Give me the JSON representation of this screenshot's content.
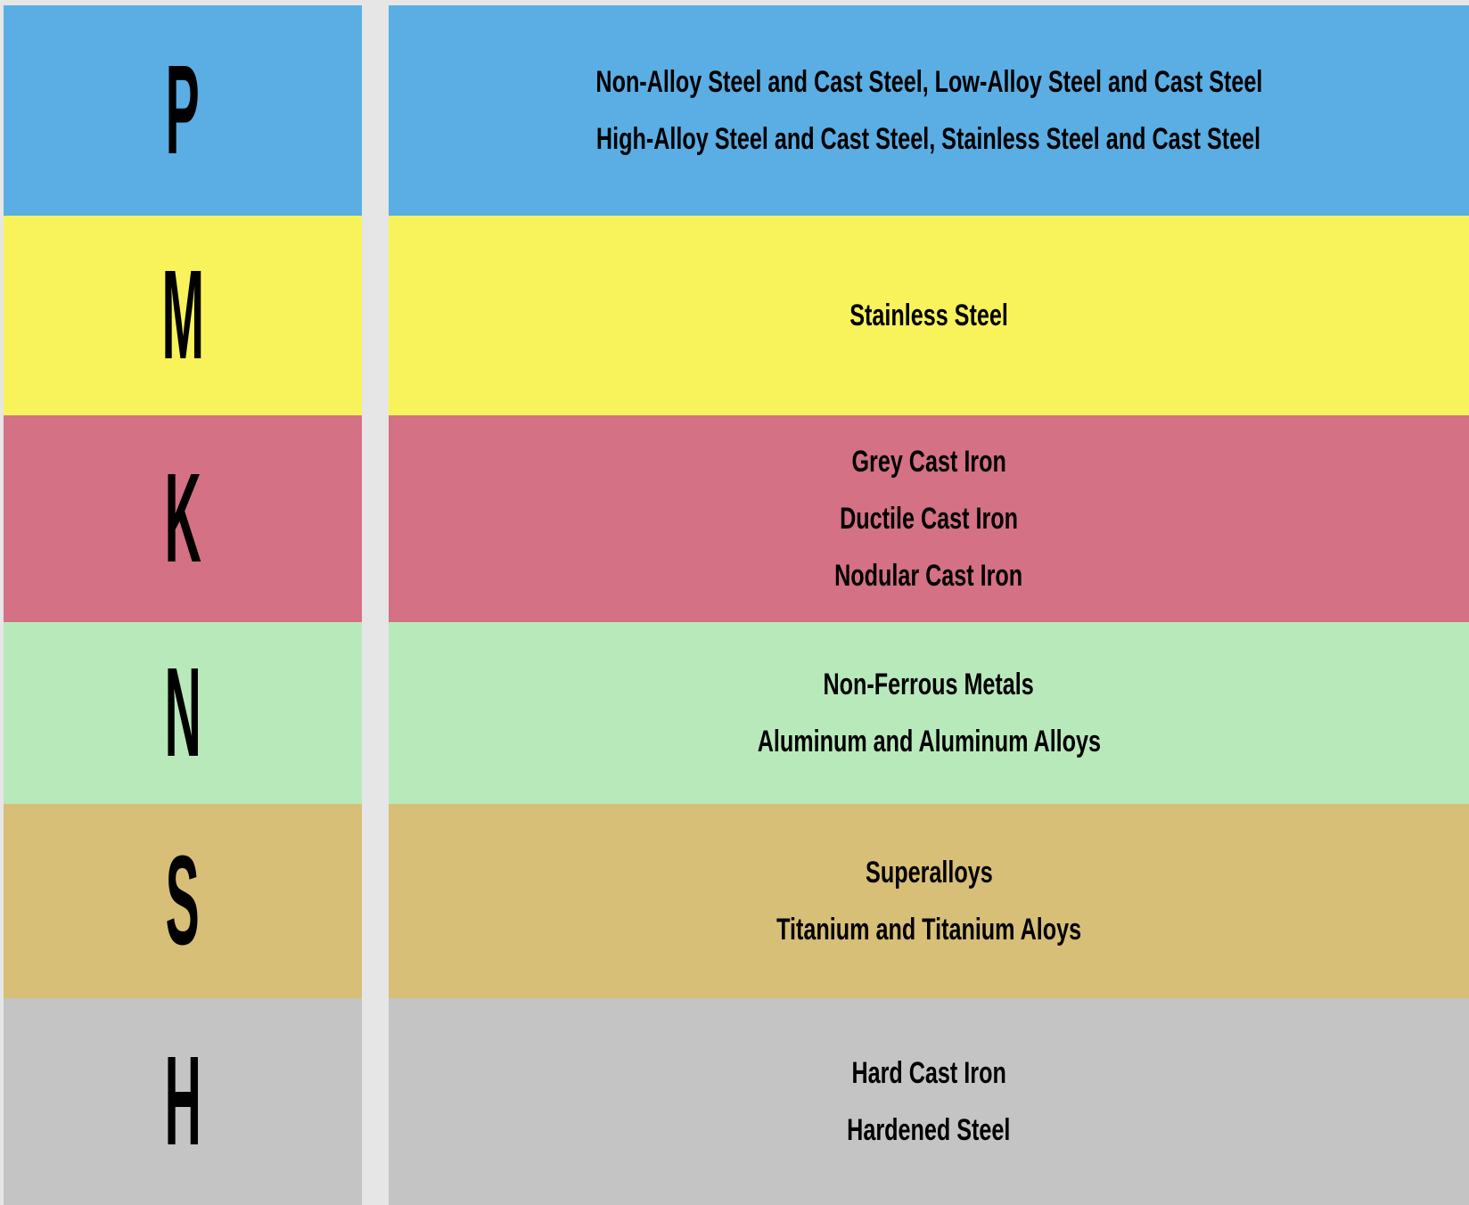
{
  "rows": [
    {
      "letter": "P",
      "color": "#5aaee4",
      "lines": [
        "Non-Alloy Steel and Cast Steel, Low-Alloy Steel and Cast Steel",
        "High-Alloy Steel and Cast Steel, Stainless Steel and Cast Steel"
      ]
    },
    {
      "letter": "M",
      "color": "#f8f35a",
      "lines": [
        "Stainless Steel"
      ]
    },
    {
      "letter": "K",
      "color": "#d47184",
      "lines": [
        "Grey Cast Iron",
        "Ductile Cast Iron",
        "Nodular Cast Iron"
      ]
    },
    {
      "letter": "N",
      "color": "#b8e9bb",
      "lines": [
        "Non-Ferrous Metals",
        "Aluminum and Aluminum Alloys"
      ]
    },
    {
      "letter": "S",
      "color": "#d8bf77",
      "lines": [
        "Superalloys",
        "Titanium and Titanium Aloys"
      ]
    },
    {
      "letter": "H",
      "color": "#c4c4c4",
      "lines": [
        "Hard Cast Iron",
        "Hardened Steel"
      ]
    }
  ]
}
